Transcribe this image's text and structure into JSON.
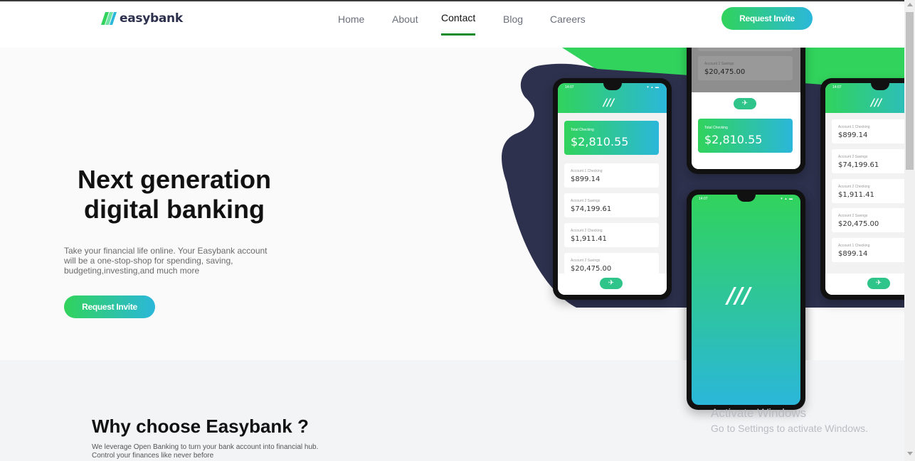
{
  "header": {
    "logo_text": "easybank",
    "nav": [
      "Home",
      "About",
      "Contact",
      "Blog",
      "Careers"
    ],
    "active_nav": "Contact",
    "cta_label": "Request Invite"
  },
  "hero": {
    "title": "Next generation digital banking",
    "description": "Take your financial life online. Your Easybank account will be a one-stop-shop for spending, saving, budgeting,investing,and much more",
    "cta_label": "Request Invite"
  },
  "phones": {
    "time": "14:07",
    "total_label": "Total Checking",
    "total_amount": "$2,810.55",
    "accounts": [
      {
        "label": "Account 1 Checking",
        "amount": "$899.14"
      },
      {
        "label": "Account 2 Savings",
        "amount": "$74,199.61"
      },
      {
        "label": "Account 2 Checking",
        "amount": "$1,911.41"
      },
      {
        "label": "Account 2 Savings",
        "amount": "$20,475.00"
      },
      {
        "label": "Account 1 Checking",
        "amount": "$899.14"
      }
    ]
  },
  "why": {
    "title": "Why choose Easybank ?",
    "description": "We leverage Open Banking to turn your bank account into financial hub. Control your finances like never before"
  },
  "watermark": {
    "line1": "Activate Windows",
    "line2": "Go to Settings to activate Windows."
  },
  "colors": {
    "green": "#31d35c",
    "cyan": "#2bb7da",
    "navy": "#2d314d",
    "active_underline": "#0f8a2a"
  }
}
